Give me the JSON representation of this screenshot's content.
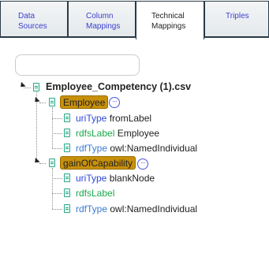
{
  "tabs": [
    {
      "id": "data_sources",
      "line1": "Data",
      "line2": "Sources"
    },
    {
      "id": "column_mappings",
      "line1": "Column",
      "line2": "Mappings"
    },
    {
      "id": "technical_mappings",
      "line1": "Technical",
      "line2": "Mappings"
    },
    {
      "id": "triples",
      "line1": "Triples",
      "line2": ""
    }
  ],
  "active_tab": "technical_mappings",
  "search": {
    "value": "",
    "placeholder": ""
  },
  "tree": {
    "root": "Employee_Competency (1).csv",
    "nodes": [
      {
        "label": "Employee",
        "more": "···",
        "children": [
          {
            "key": "uriType",
            "value": "fromLabel"
          },
          {
            "key": "rdfsLabel",
            "value": "Employee"
          },
          {
            "key": "rdfType",
            "value": "owl:NamedIndividual"
          }
        ]
      },
      {
        "label": "gainOfCapability",
        "more": "···",
        "children": [
          {
            "key": "uriType",
            "value": "blankNode"
          },
          {
            "key": "rdfsLabel",
            "value": ""
          },
          {
            "key": "rdfType",
            "value": "owl:NamedIndividual"
          }
        ]
      }
    ]
  },
  "colors": {
    "tab_border": "#2a3a46",
    "tab_link": "#3b3fd0",
    "highlight": "#c8900a",
    "uriType": "#2e49d9",
    "rdfsLabel": "#1aa84a",
    "rdfType": "#3a7bd6",
    "file_icon": "#2ca88a"
  }
}
